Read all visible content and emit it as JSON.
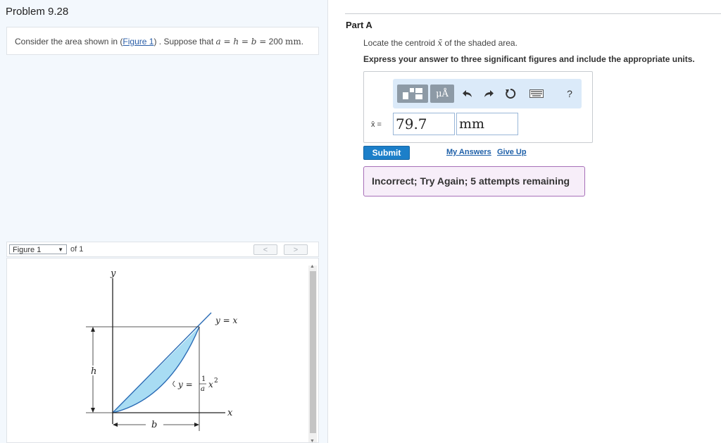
{
  "problem": {
    "title": "Problem 9.28",
    "statement_prefix": "Consider the area shown in (",
    "figure_link": "Figure 1",
    "statement_mid": ") . Suppose that ",
    "equation_lhs": "a = h = b =",
    "equation_value": " 200 ",
    "equation_unit": "mm",
    "statement_end": "."
  },
  "figure": {
    "select_value": "Figure 1",
    "of_text": "of 1",
    "prev": "<",
    "next": ">",
    "labels": {
      "y_axis": "y",
      "x_axis": "x",
      "line": "y = x",
      "h": "h",
      "b": "b",
      "curve_y": "y =",
      "curve_num": "1",
      "curve_den": "a",
      "curve_x2": "x",
      "curve_exp": "2"
    }
  },
  "part": {
    "title": "Part A",
    "instruction_prefix": "Locate the centroid ",
    "instruction_var": "x̄",
    "instruction_suffix": " of the shaded area.",
    "express": "Express your answer to three significant figures and include the appropriate units."
  },
  "toolbar": {
    "templates_icon": "templates-icon",
    "units_label": "μÅ",
    "help_label": "?"
  },
  "answer": {
    "label": "x̄ =",
    "value": "79.7",
    "unit": "mm"
  },
  "actions": {
    "submit": "Submit",
    "my_answers": "My Answers",
    "give_up": "Give Up"
  },
  "feedback": {
    "message": "Incorrect; Try Again; 5 attempts remaining"
  },
  "colors": {
    "shaded_area": "#a8dcf3",
    "feedback_border": "#a770b8",
    "submit_bg": "#1c7fc9"
  }
}
